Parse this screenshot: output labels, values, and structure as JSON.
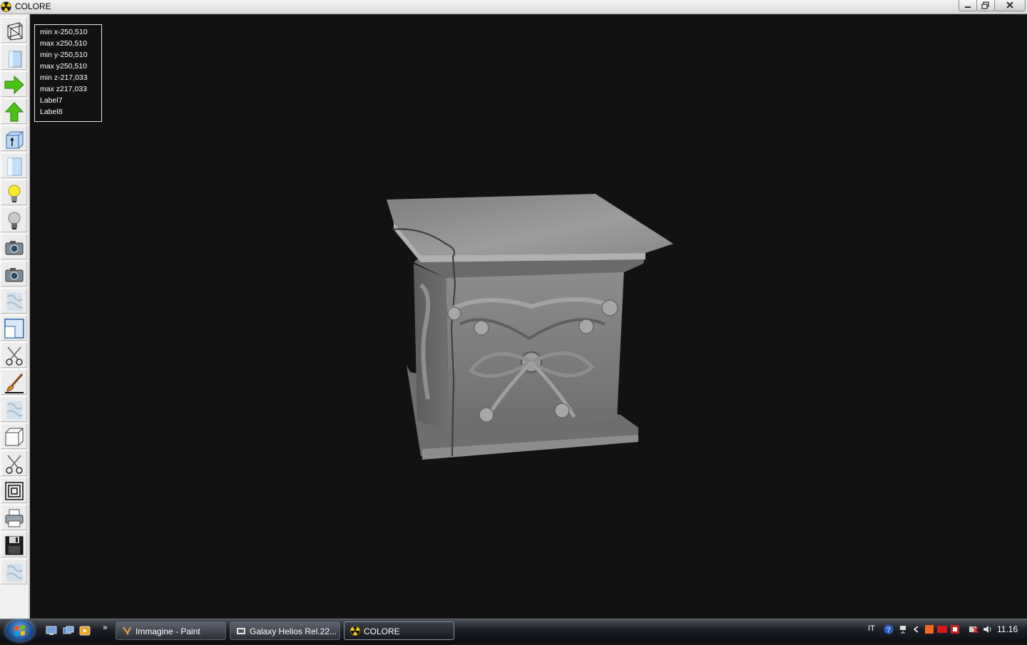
{
  "window": {
    "title": "COLORE",
    "buttons": [
      "minimize",
      "restore",
      "close"
    ]
  },
  "toolbar": {
    "tools": [
      "wireframe-cube-icon",
      "shaded-cube-icon",
      "arrow-right-icon",
      "arrow-up-icon",
      "cube-up-icon",
      "cylinder-icon",
      "lightbulb-on-icon",
      "lightbulb-off-icon",
      "camera-icon",
      "camera-2-icon",
      "texture-icon",
      "viewport-icon",
      "scissors-icon",
      "brush-icon",
      "texture-2-icon",
      "box-icon",
      "scissors-2-icon",
      "concentric-squares-icon",
      "printer-icon",
      "floppy-disk-icon",
      "texture-3-icon"
    ]
  },
  "info": {
    "lines": [
      "min x-250,510",
      "max x250,510",
      "min y-250,510",
      "max y250,510",
      "min z-217,033",
      "max z217,033",
      "Label7",
      "Label8"
    ]
  },
  "taskbar": {
    "tasks": [
      {
        "label": "Immagine - Paint"
      },
      {
        "label": "Galaxy Helios  Rel.22..."
      },
      {
        "label": "COLORE"
      }
    ],
    "language": "IT",
    "clock": "11.16"
  },
  "colors": {
    "viewport_bg": "#121212",
    "info_text": "#ffffff",
    "stone": "#808080"
  }
}
